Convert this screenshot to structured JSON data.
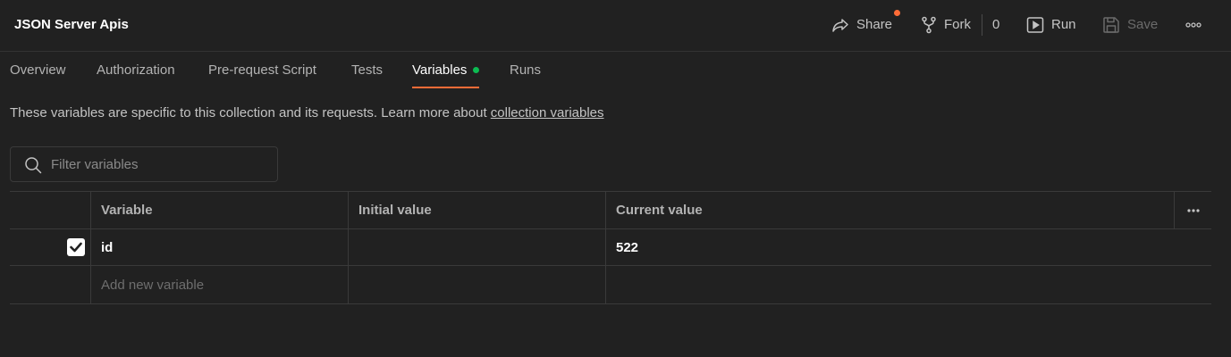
{
  "header": {
    "title": "JSON Server Apis",
    "share_label": "Share",
    "fork_label": "Fork",
    "fork_count": "0",
    "run_label": "Run",
    "save_label": "Save",
    "accent_color": "#ff6c37"
  },
  "tabs": [
    {
      "label": "Overview"
    },
    {
      "label": "Authorization"
    },
    {
      "label": "Pre-request Script"
    },
    {
      "label": "Tests"
    },
    {
      "label": "Variables",
      "active": true
    },
    {
      "label": "Runs"
    }
  ],
  "info": {
    "text": "These variables are specific to this collection and its requests. Learn more about ",
    "link_text": "collection variables"
  },
  "search": {
    "placeholder": "Filter variables",
    "value": ""
  },
  "table": {
    "columns": [
      "Variable",
      "Initial value",
      "Current value"
    ],
    "rows": [
      {
        "checked": true,
        "variable": "id",
        "initial_value": "",
        "current_value": "522"
      }
    ],
    "new_row_placeholder": "Add new variable"
  }
}
